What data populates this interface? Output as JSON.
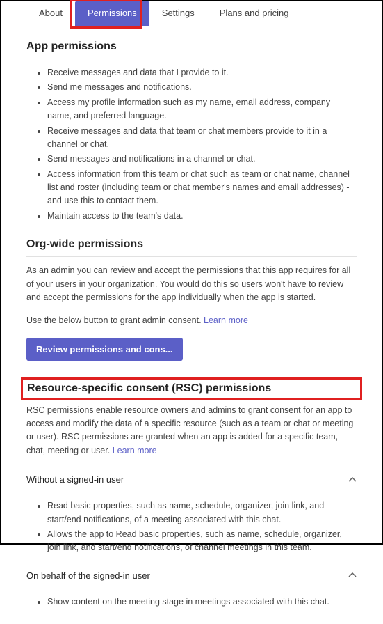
{
  "tabs": {
    "about": "About",
    "permissions": "Permissions",
    "settings": "Settings",
    "plans": "Plans and pricing"
  },
  "appPerms": {
    "heading": "App permissions",
    "items": [
      "Receive messages and data that I provide to it.",
      "Send me messages and notifications.",
      "Access my profile information such as my name, email address, company name, and preferred language.",
      "Receive messages and data that team or chat members provide to it in a channel or chat.",
      "Send messages and notifications in a channel or chat.",
      "Access information from this team or chat such as team or chat name, channel list and roster (including team or chat member's names and email addresses) - and use this to contact them.",
      "Maintain access to the team's data."
    ]
  },
  "orgPerms": {
    "heading": "Org-wide permissions",
    "desc": "As an admin you can review and accept the permissions that this app requires for all of your users in your organization. You would do this so users won't have to review and accept the permissions for the app individually when the app is started.",
    "grantText": "Use the below button to grant admin consent. ",
    "learnMore": "Learn more",
    "button": "Review permissions and cons..."
  },
  "rsc": {
    "heading": "Resource-specific consent (RSC) permissions",
    "desc": "RSC permissions enable resource owners and admins to grant consent for an app to access and modify the data of a specific resource (such as a team or chat or meeting or user). RSC permissions are granted when an app is added for a specific team, chat, meeting or user. ",
    "learnMore": "Learn more",
    "accordion1": {
      "title": "Without a signed-in user",
      "items": [
        "Read basic properties, such as name, schedule, organizer, join link, and start/end notifications, of a meeting associated with this chat.",
        "Allows the app to Read basic properties, such as name, schedule, organizer, join link, and start/end notifications, of channel meetings in this team."
      ]
    },
    "accordion2": {
      "title": "On behalf of the signed-in user",
      "items": [
        "Show content on the meeting stage in meetings associated with this chat."
      ]
    }
  }
}
